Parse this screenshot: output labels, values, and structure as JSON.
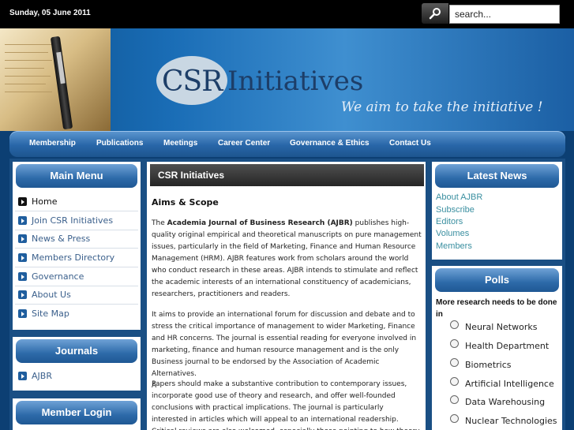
{
  "topbar": {
    "date": "Sunday, 05 June 2011",
    "search_placeholder": "search..."
  },
  "banner": {
    "logo_csr": "CSR",
    "logo_initiatives": "Initiatives",
    "tagline": "We aim to take the initiative !"
  },
  "nav": [
    "Membership",
    "Publications",
    "Meetings",
    "Career Center",
    "Governance & Ethics",
    "Contact Us"
  ],
  "main_menu": {
    "title": "Main Menu",
    "items": [
      "Home",
      "Join CSR Initiatives",
      "News & Press",
      "Members Directory",
      "Governance",
      "About Us",
      "Site Map"
    ]
  },
  "journals": {
    "title": "Journals",
    "items": [
      "AJBR"
    ]
  },
  "member_login": {
    "title": "Member Login"
  },
  "article": {
    "header": "CSR Initiatives",
    "section_title": "Aims & Scope",
    "p1_pre": "The ",
    "p1_bold": "Academia Journal of Business Research (AJBR)",
    "p1_post": " publishes high-quality original empirical and theoretical manuscripts on pure management issues, particularly in the field of Marketing, Finance and Human Resource Management (HRM). AJBR features work from scholars around the world who conduct research in these areas. AJBR intends to stimulate and reflect the academic interests of an international constituency of academicians, researchers, practitioners and readers.",
    "p2": "It aims to provide an international forum for discussion and debate and to stress the critical importance of management to wider Marketing, Finance and HR concerns. The journal is essential reading for everyone involved in marketing, finance and human resource management and is the only Business journal to be endorsed by the Association of Academic Alternatives.",
    "p2_extra": "Â",
    "p3": "Papers should make a substantive contribution to contemporary issues, incorporate good use of theory and research, and offer well-founded conclusions with practical implications. The journal is particularly interested in articles which will appeal to an international readership. Critical reviews are also welcomed, especially those pointing to how theory and practice can be"
  },
  "latest_news": {
    "title": "Latest News",
    "links": [
      "About AJBR",
      "Subscribe",
      "Editors",
      "Volumes",
      "Members"
    ]
  },
  "polls": {
    "title": "Polls",
    "question": "More research needs to be done in",
    "options": [
      "Neural Networks",
      "Health Department",
      "Biometrics",
      "Artificial Intelligence",
      "Data Warehousing",
      "Nuclear Technologies"
    ]
  }
}
